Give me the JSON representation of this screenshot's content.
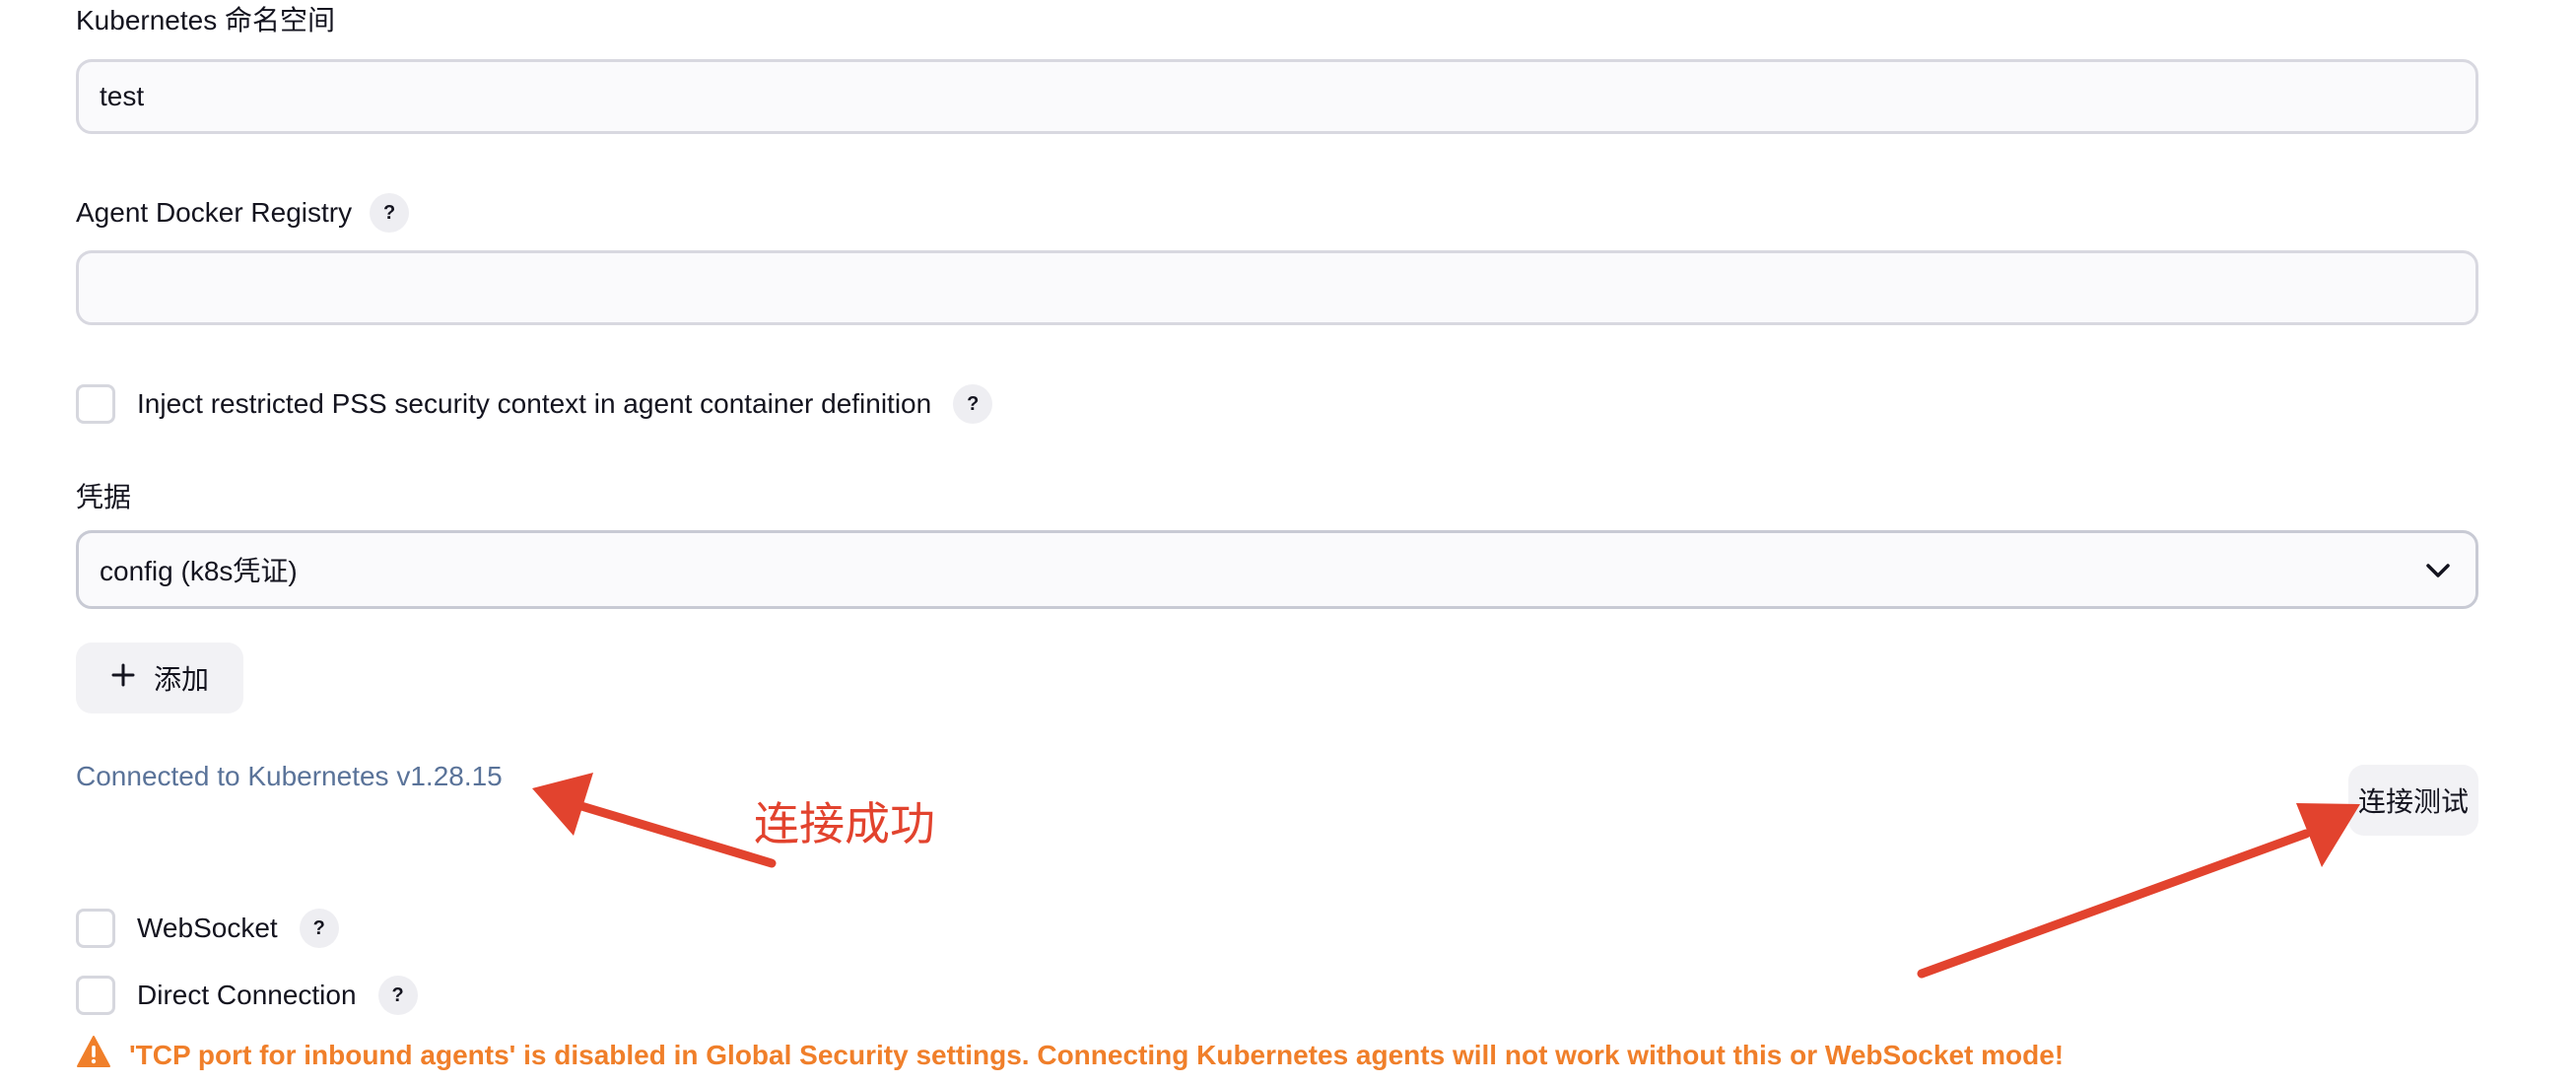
{
  "namespace": {
    "label": "Kubernetes 命名空间",
    "value": "test"
  },
  "registry": {
    "label": "Agent Docker Registry",
    "value": "",
    "help": "?"
  },
  "pss": {
    "label": "Inject restricted PSS security context in agent container definition",
    "help": "?",
    "checked": false
  },
  "credentials": {
    "label": "凭据",
    "selected": "config (k8s凭证)",
    "add_label": "添加",
    "add_icon": "plus-icon"
  },
  "connection": {
    "status": "Connected to Kubernetes v1.28.15",
    "test_button": "连接测试"
  },
  "annotation": {
    "text": "连接成功",
    "color": "#e2432e"
  },
  "websocket": {
    "label": "WebSocket",
    "help": "?",
    "checked": false
  },
  "direct": {
    "label": "Direct Connection",
    "help": "?",
    "checked": false
  },
  "warning": {
    "text": "'TCP port for inbound agents' is disabled in Global Security settings. Connecting Kubernetes agents will not work without this or WebSocket mode!",
    "icon": "warning-icon",
    "color": "#f07f2a"
  },
  "colors": {
    "status_text": "#5a7399",
    "input_border": "#d8d8e0",
    "button_bg": "#f2f2f5"
  }
}
